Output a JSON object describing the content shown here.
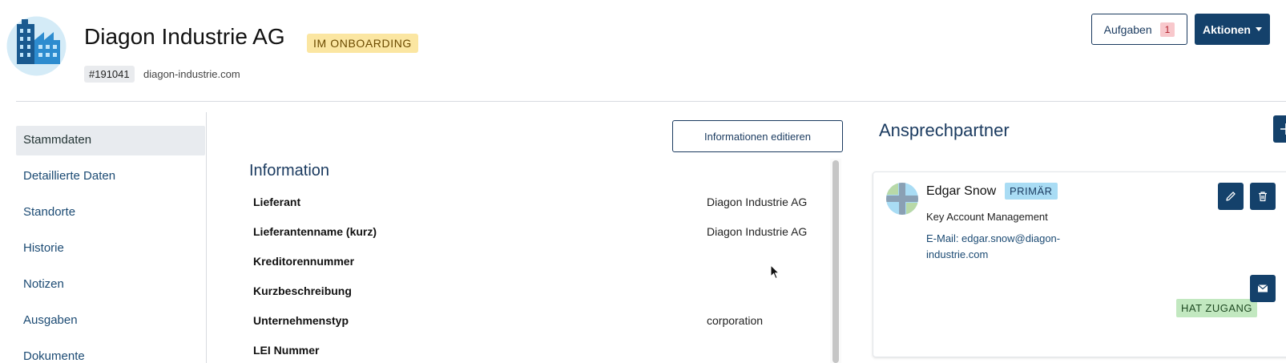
{
  "header": {
    "company_name": "Diagon Industrie AG",
    "status": "IM ONBOARDING",
    "id": "#191041",
    "domain": "diagon-industrie.com",
    "tasks_label": "Aufgaben",
    "tasks_count": "1",
    "actions_label": "Aktionen"
  },
  "sidebar": {
    "items": [
      {
        "label": "Stammdaten",
        "active": true
      },
      {
        "label": "Detaillierte Daten"
      },
      {
        "label": "Standorte"
      },
      {
        "label": "Historie"
      },
      {
        "label": "Notizen"
      },
      {
        "label": "Ausgaben"
      },
      {
        "label": "Dokumente"
      }
    ]
  },
  "info": {
    "edit_label": "Informationen editieren",
    "title": "Information",
    "rows": [
      {
        "label": "Lieferant",
        "value": "Diagon Industrie AG"
      },
      {
        "label": "Lieferantenname (kurz)",
        "value": "Diagon Industrie AG"
      },
      {
        "label": "Kreditorennummer",
        "value": ""
      },
      {
        "label": "Kurzbeschreibung",
        "value": ""
      },
      {
        "label": "Unternehmenstyp",
        "value": "corporation"
      },
      {
        "label": "LEI Nummer",
        "value": ""
      }
    ]
  },
  "contacts": {
    "title": "Ansprechpartner",
    "list": [
      {
        "name": "Edgar Snow",
        "badge": "PRIMÄR",
        "role": "Key Account Management",
        "email": "E-Mail: edgar.snow@diagon-industrie.com",
        "access": "HAT ZUGANG"
      }
    ]
  },
  "colors": {
    "primary": "#14416b",
    "status_badge": "#fbe6a2",
    "primary_badge": "#a9dcf4",
    "access_badge": "#c2e8c0",
    "tasks_count_bg": "#f8c8cc"
  },
  "icons": [
    "factory-logo",
    "plus-icon",
    "pencil-icon",
    "trash-icon",
    "mail-icon",
    "caret-down-icon",
    "avatar-icon"
  ]
}
